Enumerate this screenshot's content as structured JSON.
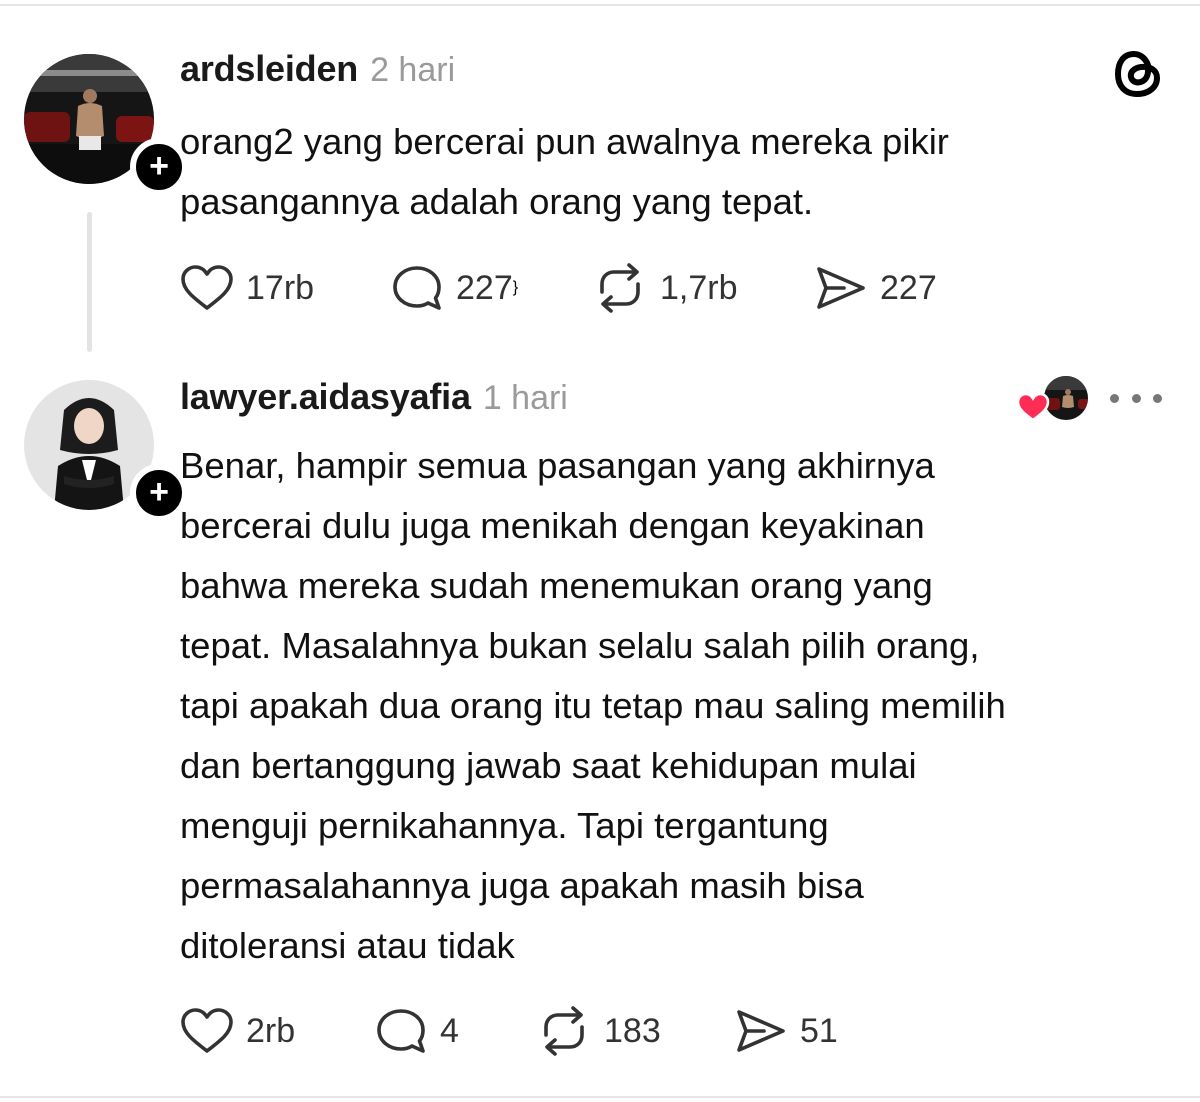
{
  "posts": [
    {
      "username": "ardsleiden",
      "timestamp": "2 hari",
      "text_lines": [
        "orang2 yang bercerai pun awalnya mereka pikir",
        "pasangannya adalah orang yang tepat."
      ],
      "counts": {
        "likes": "17rb",
        "replies": "227",
        "reposts": "1,7rb",
        "shares": "227"
      }
    },
    {
      "username": "lawyer.aidasyafia",
      "timestamp": "1 hari",
      "text_lines": [
        "Benar, hampir semua pasangan yang akhirnya",
        "bercerai dulu juga menikah dengan keyakinan",
        "bahwa mereka sudah menemukan orang yang",
        "tepat. Masalahnya bukan selalu salah pilih orang,",
        "tapi apakah dua orang itu tetap mau saling memilih",
        "dan bertanggung jawab saat kehidupan mulai",
        "menguji pernikahannya. Tapi tergantung",
        "permasalahannya juga apakah masih bisa",
        "ditoleransi atau tidak"
      ],
      "counts": {
        "likes": "2rb",
        "replies": "4",
        "reposts": "183",
        "shares": "51"
      }
    }
  ],
  "icons": {
    "follow": "plus-icon",
    "like": "heart-icon",
    "reply": "speech-bubble-icon",
    "repost": "repost-arrows-icon",
    "share": "paper-plane-icon",
    "app": "threads-logo-icon",
    "more": "ellipsis-icon"
  },
  "colors": {
    "text": "#111111",
    "muted": "#9a9a9a",
    "icon": "#333333",
    "liked_heart": "#ff2d55",
    "thread_line": "#e3e3e3"
  },
  "glyphs": {
    "plus": "+"
  }
}
